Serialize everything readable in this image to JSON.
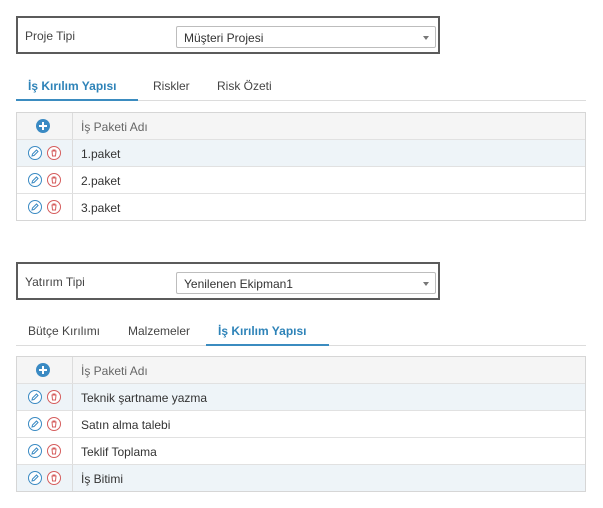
{
  "section1": {
    "type_label": "Proje Tipi",
    "type_value": "Müşteri Projesi",
    "tabs": [
      {
        "label": "İş Kırılım Yapısı",
        "active": true
      },
      {
        "label": "Riskler",
        "active": false
      },
      {
        "label": "Risk Özeti",
        "active": false
      }
    ],
    "table_header": "İş Paketi Adı",
    "rows": [
      "1.paket",
      "2.paket",
      "3.paket"
    ]
  },
  "section2": {
    "type_label": "Yatırım Tipi",
    "type_value": "Yenilenen Ekipman1",
    "tabs": [
      {
        "label": "Bütçe Kırılımı",
        "active": false
      },
      {
        "label": "Malzemeler",
        "active": false
      },
      {
        "label": "İş Kırılım Yapısı",
        "active": true
      }
    ],
    "table_header": "İş Paketi Adı",
    "rows": [
      "Teknik şartname yazma",
      "Satın alma talebi",
      "Teklif Toplama",
      "İş Bitimi"
    ]
  },
  "colors": {
    "accent": "#2e83b8",
    "delete": "#d55c5c",
    "row_alt": "#eef4f8"
  },
  "icons": {
    "add": "plus-circle-icon",
    "edit": "pencil-icon",
    "delete": "trash-icon"
  }
}
